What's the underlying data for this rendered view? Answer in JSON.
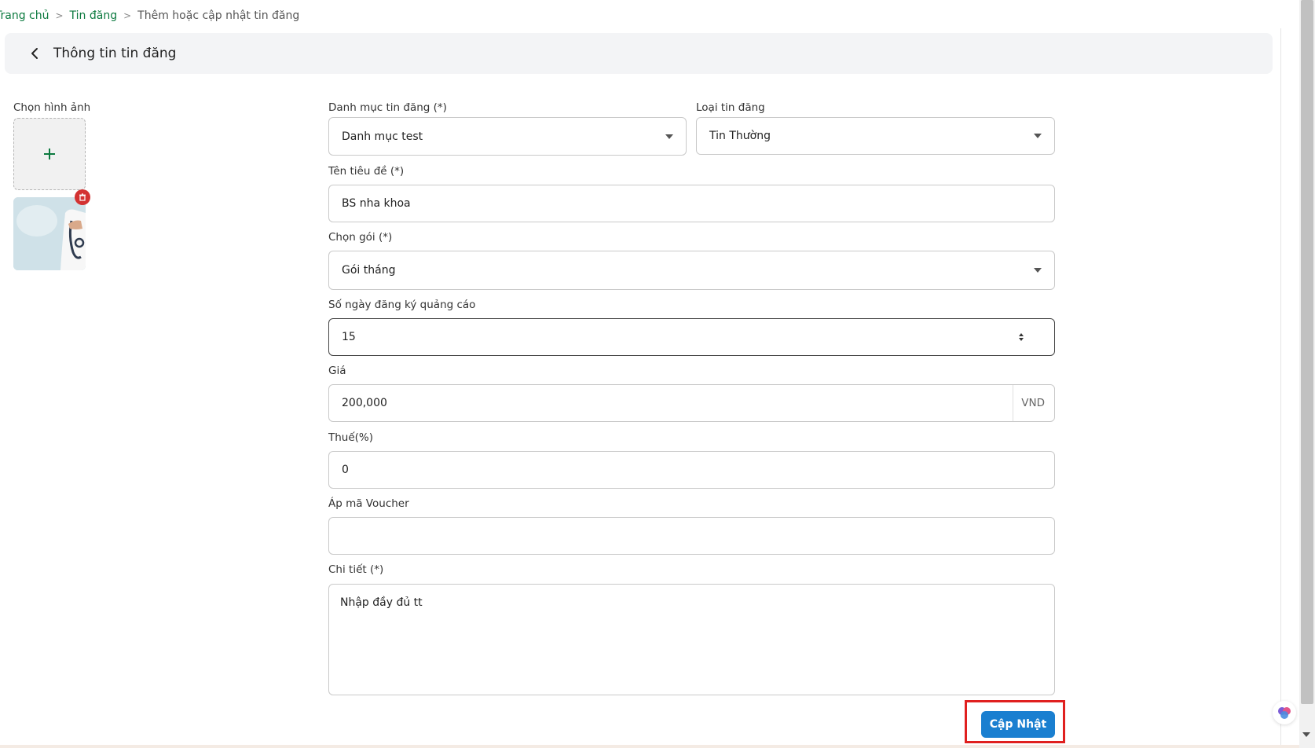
{
  "breadcrumb": {
    "home": "Trang chủ",
    "posts": "Tin đăng",
    "current": "Thêm hoặc cập nhật tin đăng"
  },
  "header": {
    "title": "Thông tin tin đăng",
    "back_icon": "chevron-left-icon"
  },
  "image_section": {
    "label": "Chọn hình ảnh",
    "add_icon": "plus-icon",
    "delete_icon": "trash-icon"
  },
  "form": {
    "category": {
      "label": "Danh mục tin đăng (*)",
      "value": "Danh mục test"
    },
    "post_type": {
      "label": "Loại tin đăng",
      "value": "Tin Thường"
    },
    "title": {
      "label": "Tên tiêu đề (*)",
      "value": "BS nha khoa"
    },
    "package": {
      "label": "Chọn gói (*)",
      "value": "Gói tháng"
    },
    "ad_days": {
      "label": "Số ngày đăng ký quảng cáo",
      "value": "15"
    },
    "price": {
      "label": "Giá",
      "value": "200,000",
      "suffix": "VND"
    },
    "tax": {
      "label": "Thuế(%)",
      "value": "0"
    },
    "voucher": {
      "label": "Áp mã Voucher",
      "value": ""
    },
    "detail": {
      "label": "Chi tiết (*)",
      "value": "Nhập đầy đủ tt"
    }
  },
  "actions": {
    "update_label": "Cập Nhật"
  },
  "colors": {
    "accent_green": "#0c7a3f",
    "primary_button": "#1a7fd0",
    "highlight_red": "#e0201f",
    "delete_red": "#d33232"
  }
}
